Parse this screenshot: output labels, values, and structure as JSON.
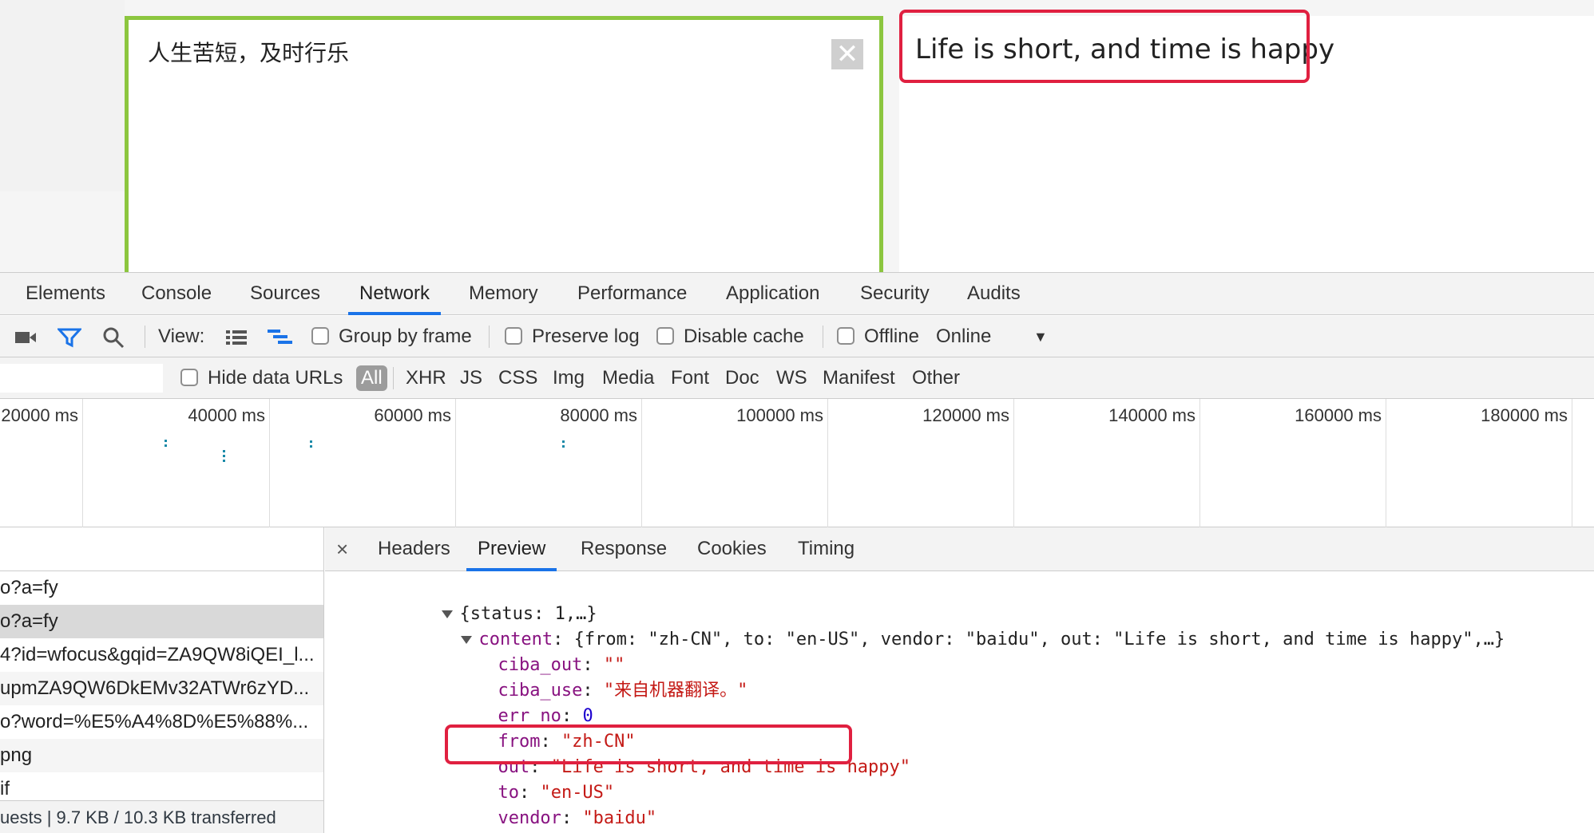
{
  "translator": {
    "source_text": "人生苦短，及时行乐",
    "clear_icon": "close-icon",
    "result_text": "Life is short, and time is happy"
  },
  "devtools": {
    "tabs": [
      "Elements",
      "Console",
      "Sources",
      "Network",
      "Memory",
      "Performance",
      "Application",
      "Security",
      "Audits"
    ],
    "active_tab": "Network",
    "toolbar": {
      "record_icon": "video-camera-icon",
      "filter_icon": "filter-icon",
      "search_icon": "search-icon",
      "view_label": "View:",
      "list_view_icon": "list-view-icon",
      "waterfall_view_icon": "waterfall-view-icon",
      "group_by_frame": "Group by frame",
      "preserve_log": "Preserve log",
      "disable_cache": "Disable cache",
      "offline": "Offline",
      "throttle_value": "Online",
      "dropdown_icon": "caret-down-icon"
    },
    "filterbar": {
      "hide_data_urls": "Hide data URLs",
      "all": "All",
      "types": [
        "XHR",
        "JS",
        "CSS",
        "Img",
        "Media",
        "Font",
        "Doc",
        "WS",
        "Manifest",
        "Other"
      ]
    },
    "overview": {
      "ticks": [
        "20000 ms",
        "40000 ms",
        "60000 ms",
        "80000 ms",
        "100000 ms",
        "120000 ms",
        "140000 ms",
        "160000 ms",
        "180000 ms"
      ]
    },
    "requests": [
      "o?a=fy",
      "o?a=fy",
      "4?id=wfocus&gqid=ZA9QW8iQEI_l...",
      "upmZA9QW6DkEMv32ATWr6zYD...",
      "o?word=%E5%A4%8D%E5%88%...",
      "png",
      "if"
    ],
    "summary": "uests | 9.7 KB / 10.3 KB transferred",
    "detail_tabs": [
      "Headers",
      "Preview",
      "Response",
      "Cookies",
      "Timing"
    ],
    "active_detail_tab": "Preview",
    "detail_close": "×",
    "preview": {
      "root": "{status: 1,…}",
      "content_key": "content",
      "content_summary": "{from: \"zh-CN\", to: \"en-US\", vendor: \"baidu\", out: \"Life is short, and time is happy\",…}",
      "fields": [
        {
          "key": "ciba_out",
          "value": "\"\"",
          "type": "str"
        },
        {
          "key": "ciba_use",
          "value": "\"来自机器翻译。\"",
          "type": "str"
        },
        {
          "key": "err_no",
          "value": "0",
          "type": "num"
        },
        {
          "key": "from",
          "value": "\"zh-CN\"",
          "type": "str"
        },
        {
          "key": "out",
          "value": "\"Life is short, and time is happy\"",
          "type": "str"
        },
        {
          "key": "to",
          "value": "\"en-US\"",
          "type": "str"
        },
        {
          "key": "vendor",
          "value": "\"baidu\"",
          "type": "str"
        }
      ],
      "status_key": "status",
      "status_value": "1"
    }
  },
  "colors": {
    "source_border": "#8cc63f",
    "highlight": "#e02040",
    "active_tab": "#1a73e8",
    "json_key": "#881280",
    "json_string": "#c41a16",
    "json_number": "#1c00cf"
  }
}
